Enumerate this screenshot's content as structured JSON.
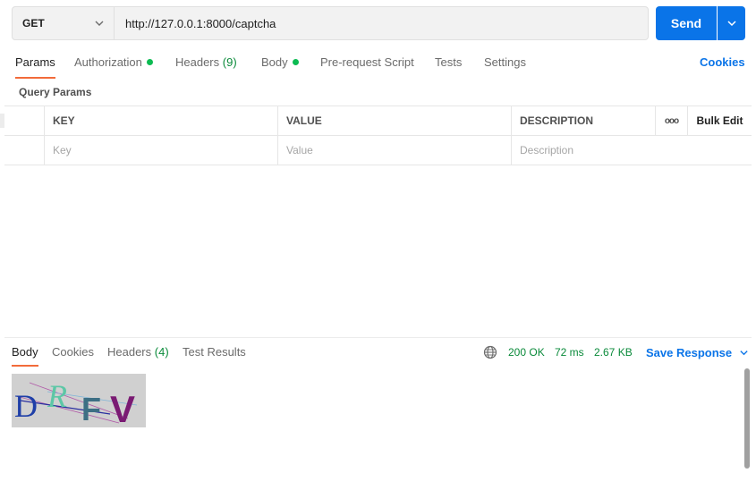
{
  "request": {
    "method": "GET",
    "url": "http://127.0.0.1:8000/captcha",
    "send_label": "Send"
  },
  "request_tabs": [
    {
      "label": "Params",
      "active": true
    },
    {
      "label": "Authorization",
      "dot": true
    },
    {
      "label": "Headers",
      "count": "(9)"
    },
    {
      "label": "Body",
      "dot": true
    },
    {
      "label": "Pre-request Script"
    },
    {
      "label": "Tests"
    },
    {
      "label": "Settings"
    }
  ],
  "cookies_label": "Cookies",
  "query_params": {
    "title": "Query Params",
    "headers": {
      "key": "KEY",
      "value": "VALUE",
      "description": "DESCRIPTION",
      "more": "ooo",
      "bulk_edit": "Bulk Edit"
    },
    "placeholders": {
      "key": "Key",
      "value": "Value",
      "description": "Description"
    }
  },
  "response_tabs": [
    {
      "label": "Body",
      "active": true
    },
    {
      "label": "Cookies"
    },
    {
      "label": "Headers",
      "count": "(4)"
    },
    {
      "label": "Test Results"
    }
  ],
  "response_status": {
    "status": "200 OK",
    "time": "72 ms",
    "size": "2.67 KB"
  },
  "save_response_label": "Save Response",
  "captcha": {
    "letters": [
      "D",
      "R",
      "F",
      "V"
    ],
    "letter_colors": [
      "#1f3fa8",
      "#5cc7a6",
      "#3d6f84",
      "#7a1a73"
    ]
  },
  "colors": {
    "accent": "#0a74e8",
    "active_tab_underline": "#f26b3a",
    "status_green": "#0a8a3a",
    "dot_green": "#0cbb52"
  }
}
